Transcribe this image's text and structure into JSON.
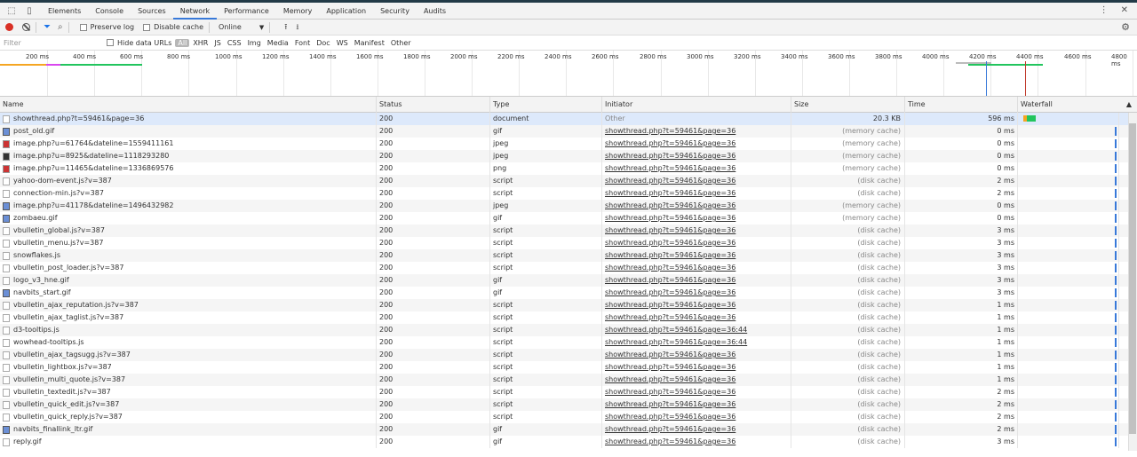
{
  "tabs": [
    "Elements",
    "Console",
    "Sources",
    "Network",
    "Performance",
    "Memory",
    "Application",
    "Security",
    "Audits"
  ],
  "toolbar": {
    "preserve_log": "Preserve log",
    "disable_cache": "Disable cache",
    "throttle": "Online"
  },
  "filter": {
    "placeholder": "Filter",
    "hide_data_urls": "Hide data URLs",
    "types": [
      "All",
      "XHR",
      "JS",
      "CSS",
      "Img",
      "Media",
      "Font",
      "Doc",
      "WS",
      "Manifest",
      "Other"
    ]
  },
  "overview_ticks": [
    "200 ms",
    "400 ms",
    "600 ms",
    "800 ms",
    "1000 ms",
    "1200 ms",
    "1400 ms",
    "1600 ms",
    "1800 ms",
    "2000 ms",
    "2200 ms",
    "2400 ms",
    "2600 ms",
    "2800 ms",
    "3000 ms",
    "3200 ms",
    "3400 ms",
    "3600 ms",
    "3800 ms",
    "4000 ms",
    "4200 ms",
    "4400 ms",
    "4600 ms",
    "4800 ms"
  ],
  "columns": {
    "name": "Name",
    "status": "Status",
    "type": "Type",
    "initiator": "Initiator",
    "size": "Size",
    "time": "Time",
    "waterfall": "Waterfall"
  },
  "rows": [
    {
      "name": "showthread.php?t=59461&page=36",
      "status": "200",
      "type": "document",
      "initiator": "Other",
      "size": "20.3 KB",
      "time": "596 ms",
      "icon": "doc"
    },
    {
      "name": "post_old.gif",
      "status": "200",
      "type": "gif",
      "initiator": "showthread.php?t=59461&page=36",
      "size": "(memory cache)",
      "time": "0 ms",
      "icon": "img"
    },
    {
      "name": "image.php?u=61764&dateline=1559411161",
      "status": "200",
      "type": "jpeg",
      "initiator": "showthread.php?t=59461&page=36",
      "size": "(memory cache)",
      "time": "0 ms",
      "icon": "red"
    },
    {
      "name": "image.php?u=8925&dateline=1118293280",
      "status": "200",
      "type": "jpeg",
      "initiator": "showthread.php?t=59461&page=36",
      "size": "(memory cache)",
      "time": "0 ms",
      "icon": "dark"
    },
    {
      "name": "image.php?u=11465&dateline=1336869576",
      "status": "200",
      "type": "png",
      "initiator": "showthread.php?t=59461&page=36",
      "size": "(memory cache)",
      "time": "0 ms",
      "icon": "red"
    },
    {
      "name": "yahoo-dom-event.js?v=387",
      "status": "200",
      "type": "script",
      "initiator": "showthread.php?t=59461&page=36",
      "size": "(disk cache)",
      "time": "2 ms",
      "icon": "doc"
    },
    {
      "name": "connection-min.js?v=387",
      "status": "200",
      "type": "script",
      "initiator": "showthread.php?t=59461&page=36",
      "size": "(disk cache)",
      "time": "2 ms",
      "icon": "doc"
    },
    {
      "name": "image.php?u=41178&dateline=1496432982",
      "status": "200",
      "type": "jpeg",
      "initiator": "showthread.php?t=59461&page=36",
      "size": "(memory cache)",
      "time": "0 ms",
      "icon": "img"
    },
    {
      "name": "zombaeu.gif",
      "status": "200",
      "type": "gif",
      "initiator": "showthread.php?t=59461&page=36",
      "size": "(memory cache)",
      "time": "0 ms",
      "icon": "img"
    },
    {
      "name": "vbulletin_global.js?v=387",
      "status": "200",
      "type": "script",
      "initiator": "showthread.php?t=59461&page=36",
      "size": "(disk cache)",
      "time": "3 ms",
      "icon": "doc"
    },
    {
      "name": "vbulletin_menu.js?v=387",
      "status": "200",
      "type": "script",
      "initiator": "showthread.php?t=59461&page=36",
      "size": "(disk cache)",
      "time": "3 ms",
      "icon": "doc"
    },
    {
      "name": "snowflakes.js",
      "status": "200",
      "type": "script",
      "initiator": "showthread.php?t=59461&page=36",
      "size": "(disk cache)",
      "time": "3 ms",
      "icon": "doc"
    },
    {
      "name": "vbulletin_post_loader.js?v=387",
      "status": "200",
      "type": "script",
      "initiator": "showthread.php?t=59461&page=36",
      "size": "(disk cache)",
      "time": "3 ms",
      "icon": "doc"
    },
    {
      "name": "logo_v3_hne.gif",
      "status": "200",
      "type": "gif",
      "initiator": "showthread.php?t=59461&page=36",
      "size": "(disk cache)",
      "time": "3 ms",
      "icon": "doc"
    },
    {
      "name": "navbits_start.gif",
      "status": "200",
      "type": "gif",
      "initiator": "showthread.php?t=59461&page=36",
      "size": "(disk cache)",
      "time": "3 ms",
      "icon": "img"
    },
    {
      "name": "vbulletin_ajax_reputation.js?v=387",
      "status": "200",
      "type": "script",
      "initiator": "showthread.php?t=59461&page=36",
      "size": "(disk cache)",
      "time": "1 ms",
      "icon": "doc"
    },
    {
      "name": "vbulletin_ajax_taglist.js?v=387",
      "status": "200",
      "type": "script",
      "initiator": "showthread.php?t=59461&page=36",
      "size": "(disk cache)",
      "time": "1 ms",
      "icon": "doc"
    },
    {
      "name": "d3-tooltips.js",
      "status": "200",
      "type": "script",
      "initiator": "showthread.php?t=59461&page=36:44",
      "size": "(disk cache)",
      "time": "1 ms",
      "icon": "doc"
    },
    {
      "name": "wowhead-tooltips.js",
      "status": "200",
      "type": "script",
      "initiator": "showthread.php?t=59461&page=36:44",
      "size": "(disk cache)",
      "time": "1 ms",
      "icon": "doc"
    },
    {
      "name": "vbulletin_ajax_tagsugg.js?v=387",
      "status": "200",
      "type": "script",
      "initiator": "showthread.php?t=59461&page=36",
      "size": "(disk cache)",
      "time": "1 ms",
      "icon": "doc"
    },
    {
      "name": "vbulletin_lightbox.js?v=387",
      "status": "200",
      "type": "script",
      "initiator": "showthread.php?t=59461&page=36",
      "size": "(disk cache)",
      "time": "1 ms",
      "icon": "doc"
    },
    {
      "name": "vbulletin_multi_quote.js?v=387",
      "status": "200",
      "type": "script",
      "initiator": "showthread.php?t=59461&page=36",
      "size": "(disk cache)",
      "time": "1 ms",
      "icon": "doc"
    },
    {
      "name": "vbulletin_textedit.js?v=387",
      "status": "200",
      "type": "script",
      "initiator": "showthread.php?t=59461&page=36",
      "size": "(disk cache)",
      "time": "2 ms",
      "icon": "doc"
    },
    {
      "name": "vbulletin_quick_edit.js?v=387",
      "status": "200",
      "type": "script",
      "initiator": "showthread.php?t=59461&page=36",
      "size": "(disk cache)",
      "time": "2 ms",
      "icon": "doc"
    },
    {
      "name": "vbulletin_quick_reply.js?v=387",
      "status": "200",
      "type": "script",
      "initiator": "showthread.php?t=59461&page=36",
      "size": "(disk cache)",
      "time": "2 ms",
      "icon": "doc"
    },
    {
      "name": "navbits_finallink_ltr.gif",
      "status": "200",
      "type": "gif",
      "initiator": "showthread.php?t=59461&page=36",
      "size": "(disk cache)",
      "time": "2 ms",
      "icon": "img"
    },
    {
      "name": "reply.gif",
      "status": "200",
      "type": "gif",
      "initiator": "showthread.php?t=59461&page=36",
      "size": "(disk cache)",
      "time": "3 ms",
      "icon": "doc"
    }
  ]
}
